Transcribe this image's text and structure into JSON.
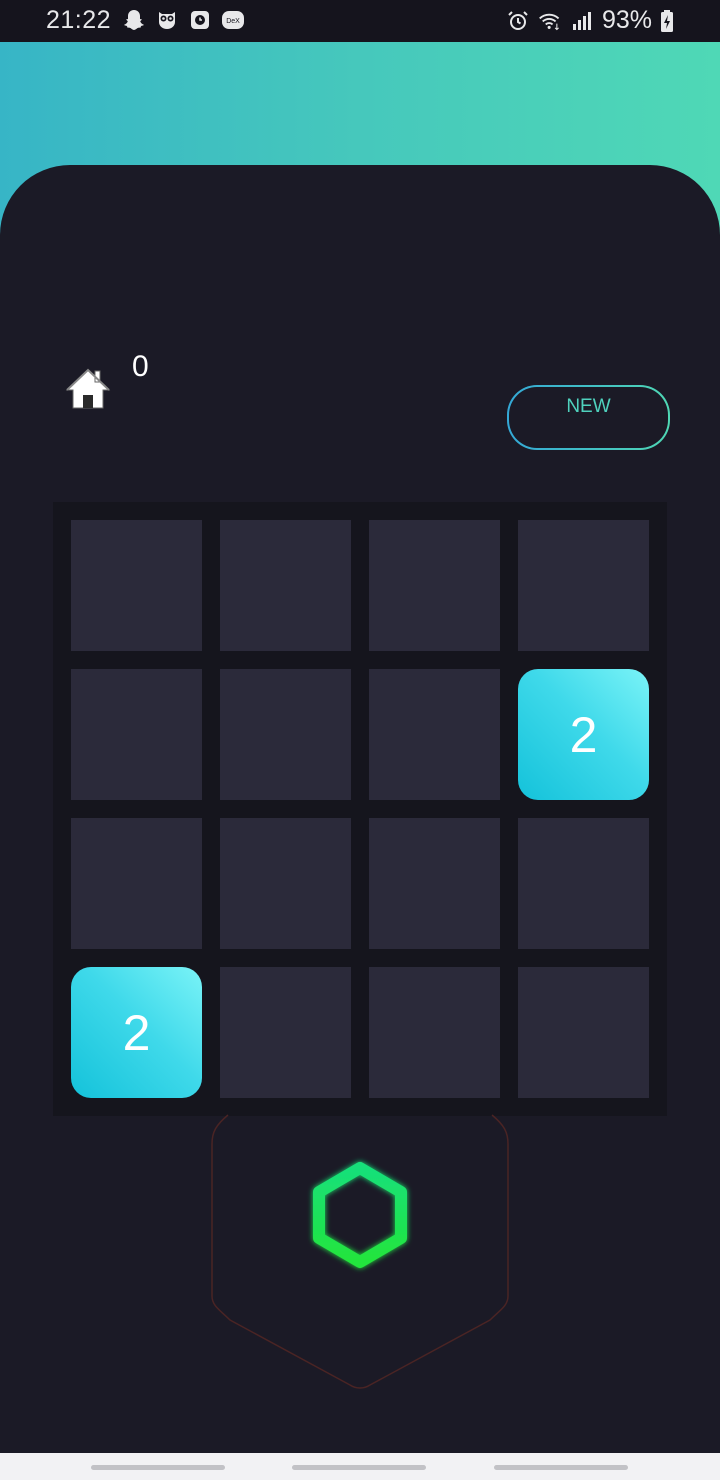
{
  "status_bar": {
    "time": "21:22",
    "battery": "93%",
    "left_icons": [
      "snapchat-icon",
      "owl-icon",
      "clock-app-icon",
      "dex-icon"
    ],
    "right_icons": [
      "alarm-icon",
      "wifi-icon",
      "signal-icon",
      "battery-charging-icon"
    ],
    "dex_label": "DeX"
  },
  "header": {
    "score": "0",
    "new_button_label": "NEW"
  },
  "board": {
    "rows": [
      [
        "",
        "",
        "",
        ""
      ],
      [
        "",
        "",
        "",
        "2"
      ],
      [
        "",
        "",
        "",
        ""
      ],
      [
        "2",
        "",
        "",
        ""
      ]
    ]
  },
  "colors": {
    "background": "#1b1a26",
    "gradient_start": "#37b5c6",
    "gradient_end": "#4fd8b6",
    "empty_cell": "#2b2a3a",
    "tile_2": "#3fd9ea",
    "hex_glow": "#1ee860"
  }
}
